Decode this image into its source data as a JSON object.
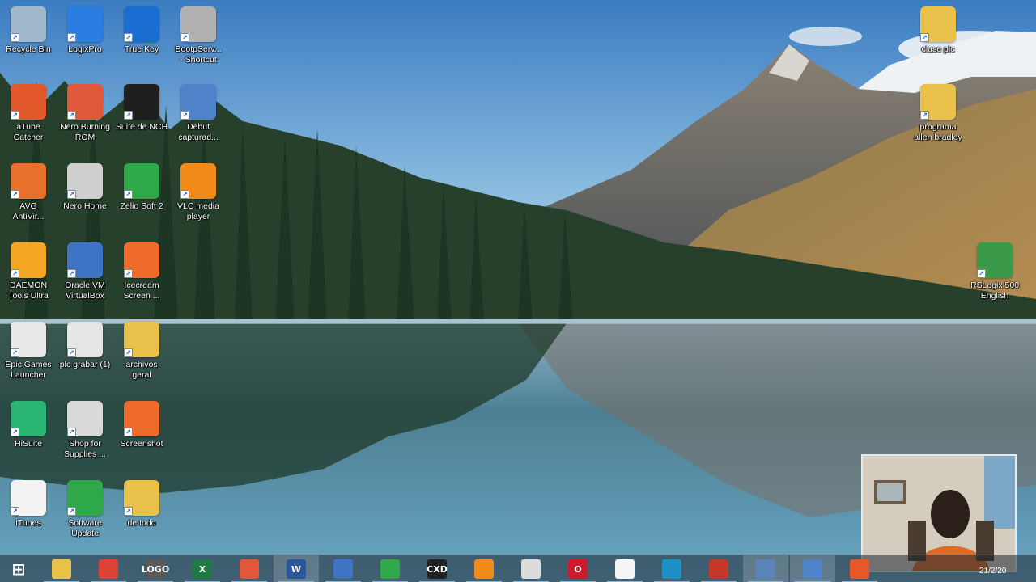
{
  "desktop": {
    "icons": [
      {
        "label": "Recycle Bin",
        "icon": "recycle-bin-icon",
        "color": "#9fb8cc"
      },
      {
        "label": "LogixPro",
        "icon": "logixpro-icon",
        "color": "#2a7de1"
      },
      {
        "label": "True Key",
        "icon": "true-key-icon",
        "color": "#1b6ed1"
      },
      {
        "label": "BootpServ...\n- Shortcut",
        "icon": "bootp-server-icon",
        "color": "#b0b0b0"
      },
      {
        "label": "aTube\nCatcher",
        "icon": "atube-catcher-icon",
        "color": "#e2582a"
      },
      {
        "label": "Nero Burning\nROM",
        "icon": "nero-burning-rom-icon",
        "color": "#e0583a"
      },
      {
        "label": "Suite de NCH",
        "icon": "nch-suite-icon",
        "color": "#1f1f1f"
      },
      {
        "label": "Debut\ncapturad...",
        "icon": "debut-video-capture-icon",
        "color": "#4f83c9"
      },
      {
        "label": "AVG\nAntiVir...",
        "icon": "avg-antivirus-icon",
        "color": "#e8702a"
      },
      {
        "label": "Nero Home",
        "icon": "nero-home-icon",
        "color": "#cfcfcf"
      },
      {
        "label": "Zelio Soft 2",
        "icon": "zelio-soft-icon",
        "color": "#2fa84a"
      },
      {
        "label": "VLC media\nplayer",
        "icon": "vlc-icon",
        "color": "#f08a18"
      },
      {
        "label": "DAEMON\nTools Ultra",
        "icon": "daemon-tools-icon",
        "color": "#f5a623"
      },
      {
        "label": "Oracle VM\nVirtualBox",
        "icon": "virtualbox-icon",
        "color": "#3f74c4"
      },
      {
        "label": "Icecream\nScreen ...",
        "icon": "icecream-screen-recorder-icon",
        "color": "#ef6b2b"
      },
      {
        "label": "Epic Games\nLauncher",
        "icon": "epic-games-launcher-icon",
        "color": "#e9e9e9"
      },
      {
        "label": "plc grabar (1)",
        "icon": "plc-file-icon",
        "color": "#e6e6e6"
      },
      {
        "label": "archivos\ngeral",
        "icon": "folder-icon",
        "color": "#e8c04a"
      },
      {
        "label": "HiSuite",
        "icon": "hisuite-icon",
        "color": "#2bb673"
      },
      {
        "label": "Shop for\nSupplies ...",
        "icon": "printer-icon",
        "color": "#d9d9d9"
      },
      {
        "label": "Screenshot",
        "icon": "screenshot-icon",
        "color": "#ef6b2b"
      },
      {
        "label": "iTunes",
        "icon": "itunes-icon",
        "color": "#f3f3f3"
      },
      {
        "label": "Software\nUpdate",
        "icon": "software-update-icon",
        "color": "#2fa84a"
      },
      {
        "label": "de todo",
        "icon": "folder-icon",
        "color": "#e8c04a"
      },
      {
        "label": "clase plc",
        "icon": "folder-icon",
        "color": "#e8c04a"
      },
      {
        "label": "programa\nallen bradley",
        "icon": "folder-icon",
        "color": "#e8c04a"
      },
      {
        "label": "RSLogix 500\nEnglish",
        "icon": "rslogix-500-icon",
        "color": "#3a9a4a"
      }
    ]
  },
  "taskbar": {
    "items": [
      {
        "name": "start-button",
        "icon": "windows-logo-icon",
        "color": "#ffffff",
        "text": "⊞"
      },
      {
        "name": "file-explorer",
        "icon": "file-explorer-icon",
        "color": "#e8c04a",
        "text": ""
      },
      {
        "name": "chrome",
        "icon": "chrome-icon",
        "color": "#db4437",
        "text": ""
      },
      {
        "name": "logo-soft",
        "icon": "logo-soft-comfort-icon",
        "color": "#5a5a5a",
        "text": "LOGO"
      },
      {
        "name": "excel",
        "icon": "excel-icon",
        "color": "#1f7a43",
        "text": "X"
      },
      {
        "name": "nero",
        "icon": "nero-burning-rom-icon",
        "color": "#e0583a",
        "text": ""
      },
      {
        "name": "word",
        "icon": "word-icon",
        "color": "#2b579a",
        "text": "W"
      },
      {
        "name": "virtualbox",
        "icon": "virtualbox-icon",
        "color": "#3f74c4",
        "text": ""
      },
      {
        "name": "zelio",
        "icon": "zelio-soft-icon",
        "color": "#2fa84a",
        "text": ""
      },
      {
        "name": "cxd",
        "icon": "cxd-icon",
        "color": "#222222",
        "text": "CXD"
      },
      {
        "name": "vlc",
        "icon": "vlc-icon",
        "color": "#f08a18",
        "text": ""
      },
      {
        "name": "keyboard-app",
        "icon": "keyboard-icon",
        "color": "#dcdcdc",
        "text": ""
      },
      {
        "name": "opera",
        "icon": "opera-icon",
        "color": "#d01a2a",
        "text": "O"
      },
      {
        "name": "blank-file",
        "icon": "document-icon",
        "color": "#f5f5f5",
        "text": ""
      },
      {
        "name": "photos",
        "icon": "photos-icon",
        "color": "#1e90c8",
        "text": ""
      },
      {
        "name": "recorder",
        "icon": "screen-recorder-icon",
        "color": "#c0392b",
        "text": ""
      },
      {
        "name": "rslogix",
        "icon": "rslogix-500-icon",
        "color": "#5a84b8",
        "text": ""
      },
      {
        "name": "debut",
        "icon": "debut-video-capture-icon",
        "color": "#4f83c9",
        "text": ""
      },
      {
        "name": "office",
        "icon": "office-icon",
        "color": "#e3592b",
        "text": ""
      }
    ],
    "clock": "21/2/20"
  }
}
